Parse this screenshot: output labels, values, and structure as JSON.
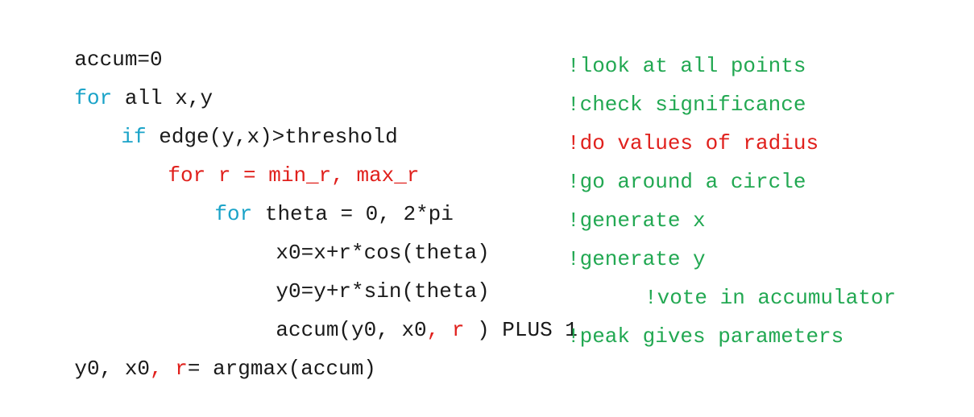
{
  "code_lines": [
    {
      "segments": [
        "accum=0"
      ],
      "comment": ""
    },
    {
      "segments": [
        "for",
        " all x,y"
      ],
      "comment": "!look at all points"
    },
    {
      "segments": [
        "if",
        " edge(y,x)>threshold"
      ],
      "comment": "!check significance"
    },
    {
      "segments": [
        "for r = min_r, max_r"
      ],
      "comment": "!do values of radius"
    },
    {
      "segments": [
        "for",
        " theta = 0, 2*pi"
      ],
      "comment": "!go around a circle"
    },
    {
      "segments": [
        "x0=x+r*cos(theta)"
      ],
      "comment": "!generate x"
    },
    {
      "segments": [
        "y0=y+r*sin(theta)"
      ],
      "comment": "!generate y"
    },
    {
      "segments": [
        "accum(y0, x0",
        ", ",
        "r",
        " ) PLUS 1"
      ],
      "comment": "!vote in accumulator"
    },
    {
      "segments": [
        "y0, x0",
        ", ",
        "r",
        "= argmax(accum)"
      ],
      "comment": "!peak gives parameters"
    }
  ],
  "colors": {
    "keyword": "#1aa3c8",
    "highlight": "#e0201c",
    "comment": "#22a852",
    "text": "#1a1a1a"
  }
}
